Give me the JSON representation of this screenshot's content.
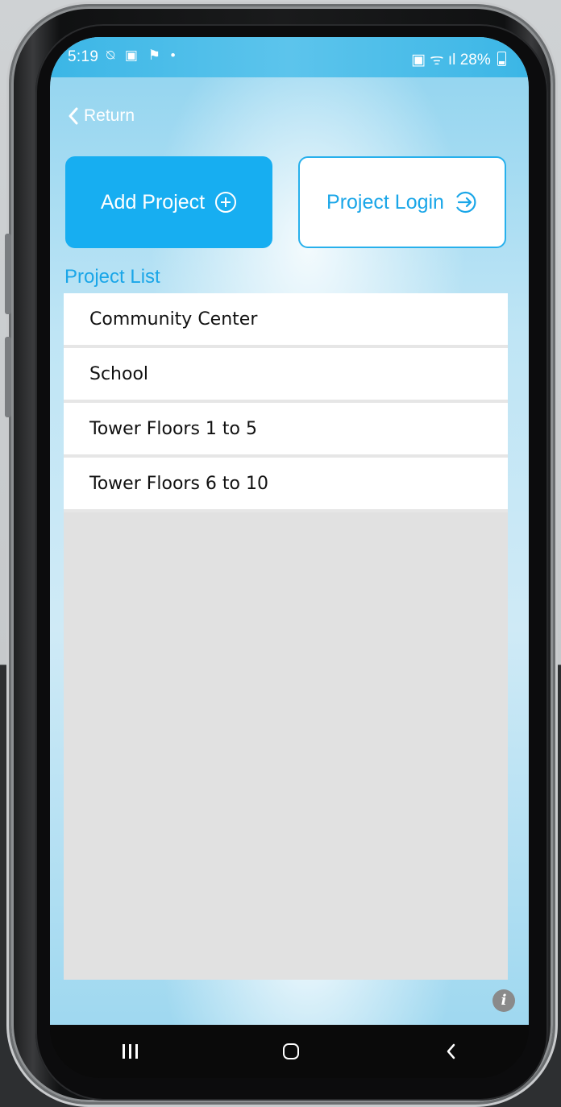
{
  "status_bar": {
    "time": "5:19",
    "left_icons": "⍉ ▣ ⚑ •",
    "right_icons": "▣ ᯤ ıl",
    "battery_percent": "28%"
  },
  "header": {
    "return_label": "Return"
  },
  "actions": {
    "add_project_label": "Add Project",
    "project_login_label": "Project Login"
  },
  "project_list": {
    "title": "Project List",
    "items": [
      "Community Center",
      "School",
      "Tower Floors 1 to 5",
      "Tower Floors 6 to 10"
    ]
  },
  "info": {
    "symbol": "i"
  },
  "colors": {
    "accent": "#17aef1",
    "status_bar": "#3bb6e6",
    "list_background": "#e1e1e1"
  },
  "icons": [
    "back-chevron-icon",
    "plus-circle-icon",
    "arrow-circle-right-icon",
    "info-icon",
    "recent-apps-icon",
    "home-icon",
    "back-icon"
  ]
}
